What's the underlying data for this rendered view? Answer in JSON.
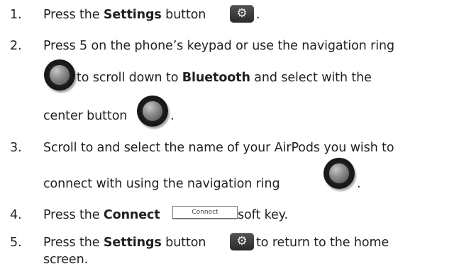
{
  "steps": [
    {
      "number": "1.",
      "pre": "Press the ",
      "bold": "Settings",
      "post": " button",
      "end": "."
    },
    {
      "number": "2.",
      "line1": "Press 5 on the phone’s keypad or use the navigation ring",
      "line2_post": " to scroll down to ",
      "line2_bold": "Bluetooth",
      "line2_end": " and select with the",
      "line3": "center button",
      "end": "."
    },
    {
      "number": "3.",
      "line1": "Scroll to and select the name of your AirPods you wish to",
      "line2": "connect with using the navigation ring",
      "end": "."
    },
    {
      "number": "4.",
      "pre": "Press the ",
      "bold": "Connect",
      "post": " soft key.",
      "softkey_label": "Connect"
    },
    {
      "number": "5.",
      "pre": "Press the ",
      "bold": "Settings",
      "post": " button",
      "post2": " to return to the home",
      "line2": "screen."
    }
  ],
  "icons": {
    "settings": "gear-icon",
    "nav_ring": "navigation-ring-icon",
    "softkey": "softkey-icon"
  }
}
